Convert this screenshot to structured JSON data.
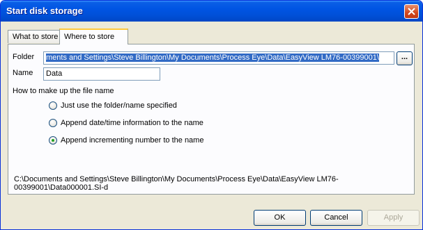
{
  "window": {
    "title": "Start disk storage"
  },
  "tabs": [
    {
      "label": "What to store",
      "active": false
    },
    {
      "label": "Where to store",
      "active": true
    }
  ],
  "form": {
    "folder_label": "Folder",
    "folder_value": "ments and Settings\\Steve Billington\\My Documents\\Process Eye\\Data\\EasyView LM76-00399001\\",
    "browse_label": "...",
    "name_label": "Name",
    "name_value": "Data",
    "filename_heading": "How to make up the file name",
    "options": [
      {
        "label": "Just use the folder/name specified",
        "checked": false
      },
      {
        "label": "Append date/time information to the name",
        "checked": false
      },
      {
        "label": "Append incrementing number to the name",
        "checked": true
      }
    ],
    "result_path": "C:\\Documents and Settings\\Steve Billington\\My Documents\\Process Eye\\Data\\EasyView LM76-00399001\\Data000001.SI-d"
  },
  "buttons": {
    "ok": "OK",
    "cancel": "Cancel",
    "apply": "Apply"
  }
}
